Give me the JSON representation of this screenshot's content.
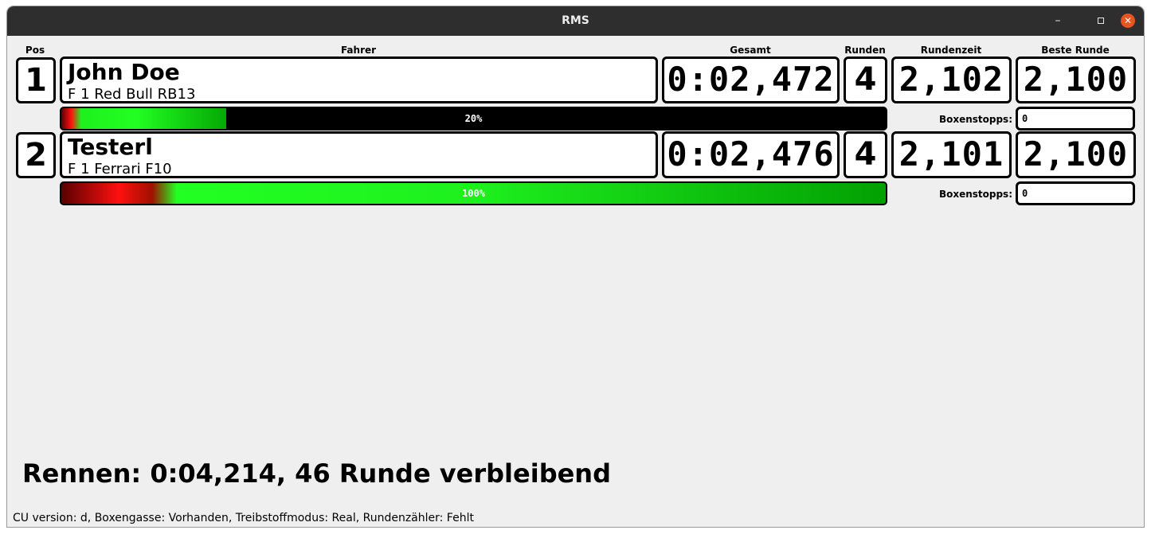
{
  "window": {
    "title": "RMS"
  },
  "headers": {
    "pos": "Pos",
    "driver": "Fahrer",
    "total": "Gesamt",
    "laps": "Runden",
    "lap_time": "Rundenzeit",
    "best_lap": "Beste Runde"
  },
  "rows": [
    {
      "pos": "1",
      "name": "John Doe",
      "car": "F 1 Red Bull RB13",
      "total": "0:02,472",
      "laps": "4",
      "lap_time": "2,102",
      "best_lap": "2,100",
      "fuel_percent": 20,
      "fuel_label": "20%",
      "pit_label": "Boxenstopps:",
      "pit_stops": "0"
    },
    {
      "pos": "2",
      "name": "Testerl",
      "car": "F 1 Ferrari F10",
      "total": "0:02,476",
      "laps": "4",
      "lap_time": "2,101",
      "best_lap": "2,100",
      "fuel_percent": 100,
      "fuel_label": "100%",
      "pit_label": "Boxenstopps:",
      "pit_stops": "0"
    }
  ],
  "race": {
    "status": "Rennen: 0:04,214, 46 Runde verbleibend"
  },
  "status_bar": {
    "text": "CU version: d, Boxengasse: Vorhanden, Treibstoffmodus: Real, Rundenzähler: Fehlt"
  },
  "colors": {
    "bar_bg": "#000000",
    "fuel_green": "#1ef01e",
    "fuel_red": "#ff1010",
    "close_button": "#e95420"
  },
  "icons": {
    "minimize": "minimize-icon",
    "maximize": "maximize-icon",
    "close": "close-icon"
  }
}
